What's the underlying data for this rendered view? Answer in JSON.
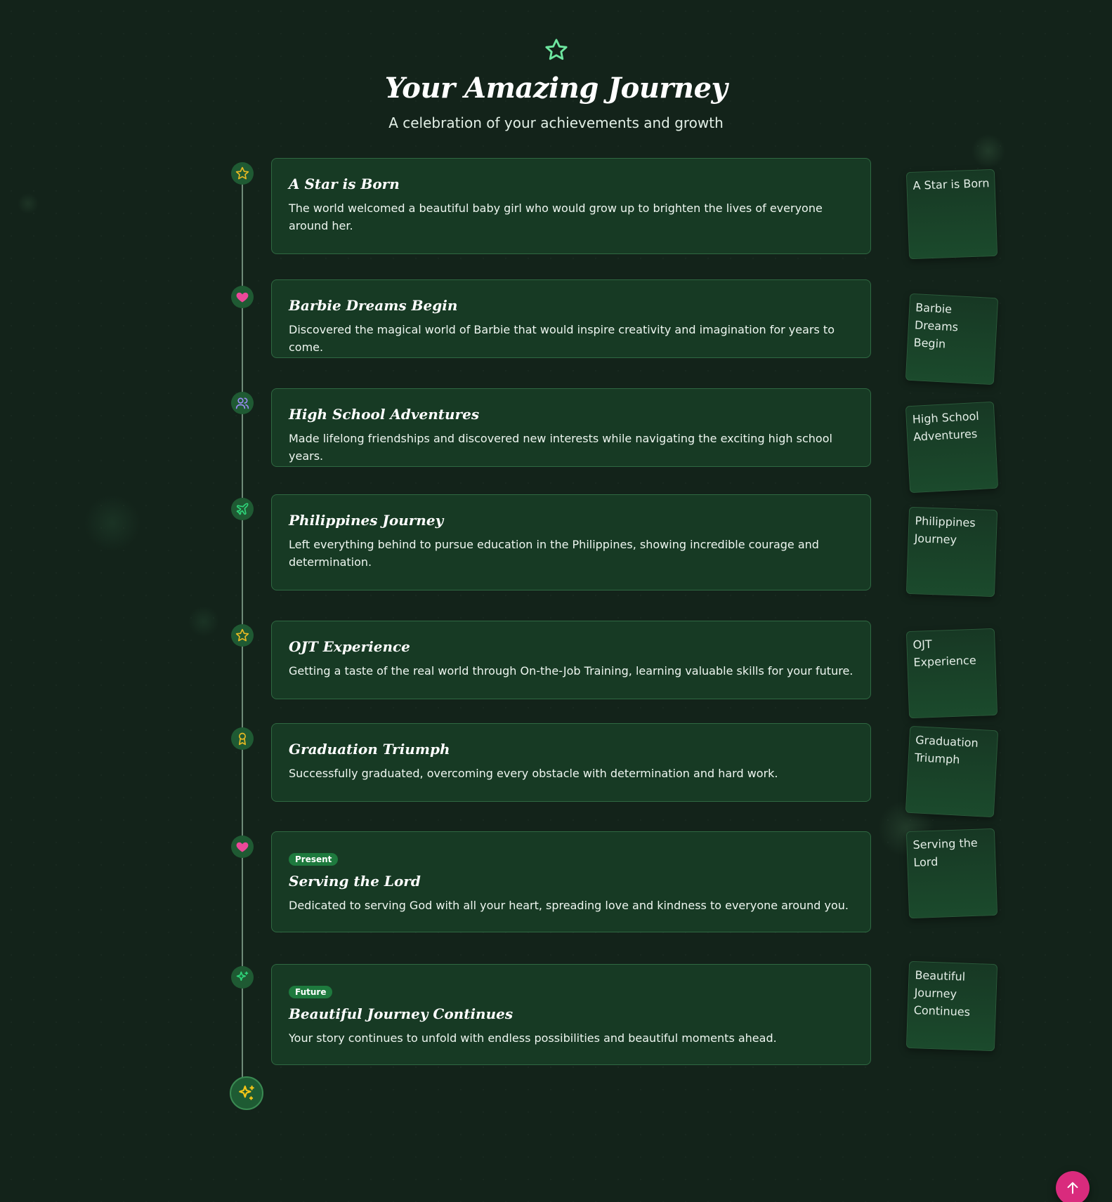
{
  "header": {
    "title": "Your Amazing Journey",
    "subtitle": "A celebration of your achievements and growth",
    "icon": "star-icon"
  },
  "milestones": [
    {
      "icon": "star-icon",
      "title": "A Star is Born",
      "description": "The world welcomed a beautiful baby girl who would grow up to brighten the lives of everyone around her.",
      "photo_label": "A Star is Born"
    },
    {
      "icon": "heart-icon",
      "title": "Barbie Dreams Begin",
      "description": "Discovered the magical world of Barbie that would inspire creativity and imagination for years to come.",
      "photo_label": "Barbie Dreams Begin"
    },
    {
      "icon": "users-icon",
      "title": "High School Adventures",
      "description": "Made lifelong friendships and discovered new interests while navigating the exciting high school years.",
      "photo_label": "High School Adventures"
    },
    {
      "icon": "plane-icon",
      "title": "Philippines Journey",
      "description": "Left everything behind to pursue education in the Philippines, showing incredible courage and determination.",
      "photo_label": "Philippines Journey"
    },
    {
      "icon": "star-icon",
      "title": "OJT Experience",
      "description": "Getting a taste of the real world through On-the-Job Training, learning valuable skills for your future.",
      "photo_label": "OJT Experience"
    },
    {
      "icon": "award-icon",
      "title": "Graduation Triumph",
      "description": "Successfully graduated, overcoming every obstacle with determination and hard work.",
      "photo_label": "Graduation Triumph"
    },
    {
      "icon": "heart-icon",
      "badge": "Present",
      "title": "Serving the Lord",
      "description": "Dedicated to serving God with all your heart, spreading love and kindness to everyone around you.",
      "photo_label": "Serving the Lord"
    },
    {
      "icon": "sparkles-icon",
      "badge": "Future",
      "title": "Beautiful Journey Continues",
      "description": "Your story continues to unfold with endless possibilities and beautiful moments ahead.",
      "photo_label": "Beautiful Journey Continues"
    }
  ],
  "end_icon": "sparkles-icon",
  "scroll_top_icon": "arrow-up-icon",
  "colors": {
    "background": "#13231a",
    "card": "#173a24",
    "card_border": "#2f6942",
    "accent_green": "#6ee7a0",
    "star_yellow": "#e8b923",
    "heart_pink": "#ec4899",
    "users_purple": "#9b8cf5",
    "scroll_button": "#d92b7d"
  }
}
